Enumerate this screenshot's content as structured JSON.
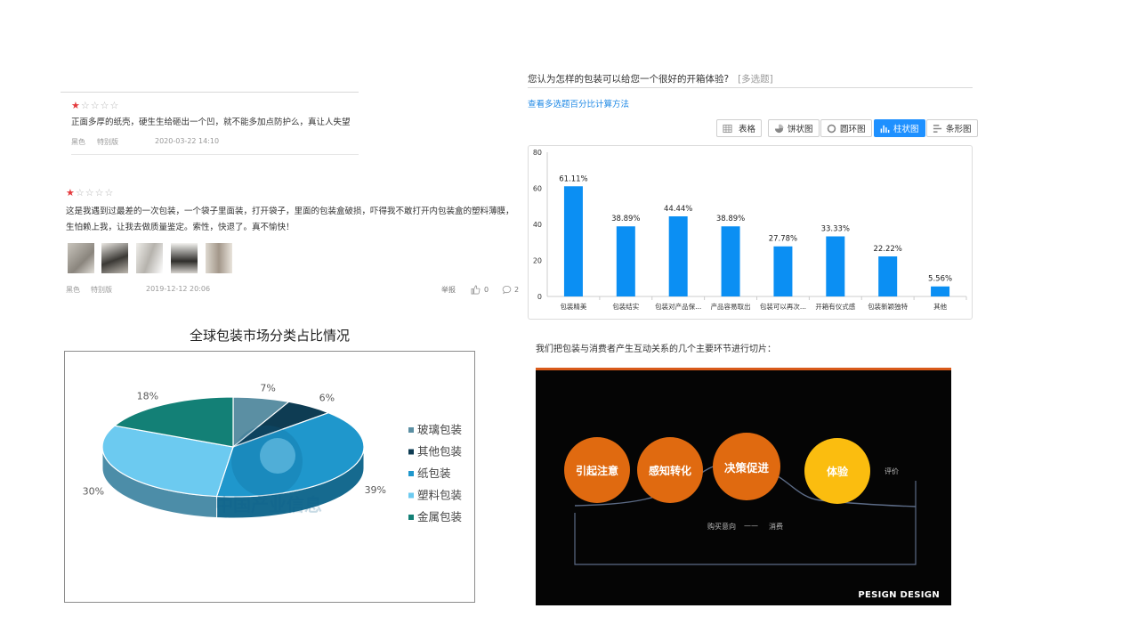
{
  "reviews": [
    {
      "rating": 1,
      "max_rating": 5,
      "text": "正面多厚的纸壳，硬生生给砸出一个凹，就不能多加点防护么，真让人失望",
      "color": "黑色",
      "edition": "特别版",
      "date": "2020-03-22 14:10"
    },
    {
      "rating": 1,
      "max_rating": 5,
      "text": "这是我遇到过最差的一次包装，一个袋子里面装，打开袋子，里面的包装盒破损，吓得我不敢打开内包装盒的塑料薄膜，生怕赖上我，让我去做质量鉴定。索性，快退了。真不愉快！",
      "color": "黑色",
      "edition": "特别版",
      "date": "2019-12-12 20:06",
      "photo_count": 5,
      "report_label": "举报",
      "like_count": "0",
      "comment_count": "2"
    }
  ],
  "pie": {
    "title": "全球包装市场分类占比情况",
    "legend": [
      "玻璃包装",
      "其他包装",
      "纸包装",
      "塑料包装",
      "金属包装"
    ],
    "watermark": "中国产业信息"
  },
  "survey": {
    "question": "您认为怎样的包装可以给您一个很好的开箱体验?",
    "question_type": "[多选题]",
    "method_link": "查看多选题百分比计算方法",
    "views": [
      {
        "label": "表格",
        "icon": "table-icon",
        "active": false
      },
      {
        "label": "饼状图",
        "icon": "pie-icon",
        "active": false
      },
      {
        "label": "圆环图",
        "icon": "ring-icon",
        "active": false
      },
      {
        "label": "柱状图",
        "icon": "bar-icon",
        "active": true
      },
      {
        "label": "条形图",
        "icon": "hbar-icon",
        "active": false
      }
    ]
  },
  "chart_data": [
    {
      "type": "pie",
      "title": "全球包装市场分类占比情况",
      "categories": [
        "玻璃包装",
        "其他包装",
        "纸包装",
        "塑料包装",
        "金属包装"
      ],
      "values": [
        7,
        6,
        39,
        30,
        18
      ],
      "unit": "%",
      "colors": [
        "#5b8fa3",
        "#0e3c53",
        "#1f97cc",
        "#6ccaf0",
        "#138076"
      ],
      "legend_position": "right"
    },
    {
      "type": "bar",
      "categories": [
        "包装精美",
        "包装结实",
        "包装对产品保...",
        "产品容易取出",
        "包装可以再次...",
        "开箱有仪式感",
        "包装新颖独特",
        "其他"
      ],
      "values": [
        61.11,
        38.89,
        44.44,
        38.89,
        27.78,
        33.33,
        22.22,
        5.56
      ],
      "data_labels": [
        "61.11%",
        "38.89%",
        "44.44%",
        "38.89%",
        "27.78%",
        "33.33%",
        "22.22%",
        "5.56%"
      ],
      "ylim": [
        0,
        80
      ],
      "yticks": [
        0,
        20,
        40,
        60,
        80
      ],
      "color": "#0b8ff3",
      "grid": false
    }
  ],
  "slide": {
    "caption": "我们把包装与消费者产生互动关系的几个主要环节进行切片：",
    "stages": [
      "引起注意",
      "感知转化",
      "决策促进",
      "体验"
    ],
    "after_label": "评价",
    "purchase_label": "购买意向",
    "dash": "——",
    "consume_label": "消费",
    "brand": "PESIGN DESIGN",
    "colors": {
      "orange": "#e06a10",
      "yellow": "#fbbd0f",
      "line": "#5c6b86"
    }
  }
}
